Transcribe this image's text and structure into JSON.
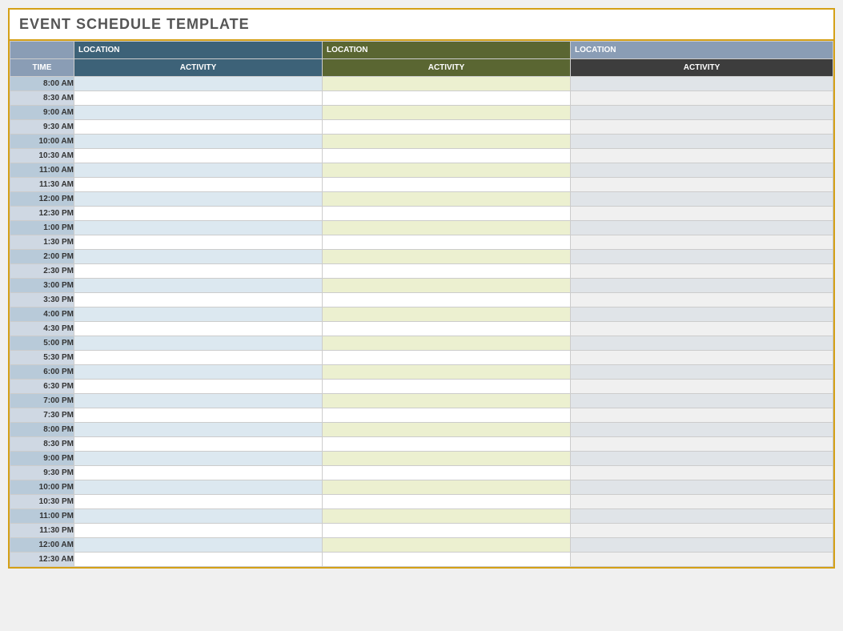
{
  "title": "EVENT SCHEDULE TEMPLATE",
  "headers": {
    "time": "TIME",
    "location": "LOCATION",
    "activity": "ACTIVITY"
  },
  "times": [
    "8:00 AM",
    "8:30 AM",
    "9:00 AM",
    "9:30 AM",
    "10:00 AM",
    "10:30 AM",
    "11:00 AM",
    "11:30 AM",
    "12:00 PM",
    "12:30 PM",
    "1:00 PM",
    "1:30 PM",
    "2:00 PM",
    "2:30 PM",
    "3:00 PM",
    "3:30 PM",
    "4:00 PM",
    "4:30 PM",
    "5:00 PM",
    "5:30 PM",
    "6:00 PM",
    "6:30 PM",
    "7:00 PM",
    "7:30 PM",
    "8:00 PM",
    "8:30 PM",
    "9:00 PM",
    "9:30 PM",
    "10:00 PM",
    "10:30 PM",
    "11:00 PM",
    "11:30 PM",
    "12:00 AM",
    "12:30 AM"
  ]
}
